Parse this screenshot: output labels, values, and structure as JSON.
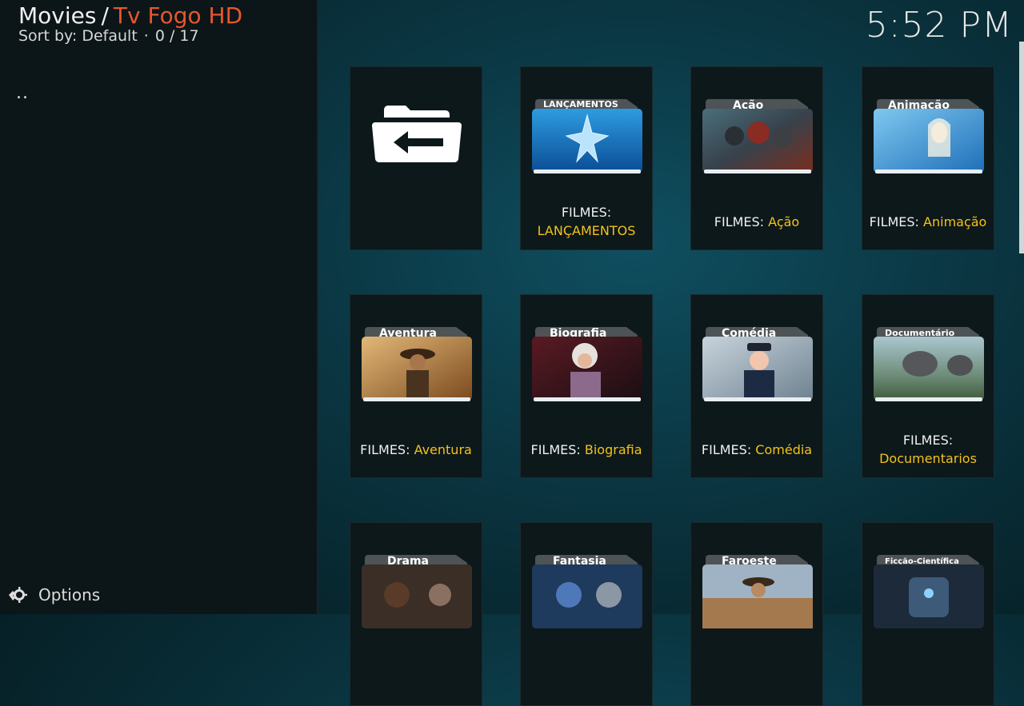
{
  "header": {
    "section": "Movies",
    "separator": "/",
    "addon": "Tv Fogo HD",
    "sort_label": "Sort by: Default",
    "dot": "·",
    "position": "0 / 17"
  },
  "clock": "5:52 PM",
  "sidebar": {
    "parent_item": "..",
    "options_label": "Options"
  },
  "tiles": [
    {
      "prefix": "",
      "genre": "",
      "tab": "",
      "icon": "back-folder-icon"
    },
    {
      "prefix": "FILMES:",
      "genre": "LANÇAMENTOS",
      "tab": "LANÇAMENTOS",
      "icon": "star-folder-icon"
    },
    {
      "prefix": "FILMES:",
      "genre": "Ação",
      "tab": "Ação",
      "icon": "action-folder-icon"
    },
    {
      "prefix": "FILMES:",
      "genre": "Animação",
      "tab": "Animação",
      "icon": "animation-folder-icon"
    },
    {
      "prefix": "FILMES:",
      "genre": "Aventura",
      "tab": "Aventura",
      "icon": "adventure-folder-icon"
    },
    {
      "prefix": "FILMES:",
      "genre": "Biografia",
      "tab": "Biografia",
      "icon": "biography-folder-icon"
    },
    {
      "prefix": "FILMES:",
      "genre": "Comédia",
      "tab": "Comédia",
      "icon": "comedy-folder-icon"
    },
    {
      "prefix": "FILMES:",
      "genre": "Documentarios",
      "tab": "Documentário",
      "icon": "documentary-folder-icon"
    },
    {
      "prefix": "",
      "genre": "",
      "tab": "Drama",
      "icon": "drama-folder-icon"
    },
    {
      "prefix": "",
      "genre": "",
      "tab": "Fantasia",
      "icon": "fantasy-folder-icon"
    },
    {
      "prefix": "",
      "genre": "",
      "tab": "Faroeste",
      "icon": "western-folder-icon"
    },
    {
      "prefix": "",
      "genre": "",
      "tab": "Ficção-Científica",
      "icon": "scifi-folder-icon"
    }
  ],
  "colors": {
    "accent_addon": "#e8562e",
    "genre_label": "#f2c21a"
  }
}
